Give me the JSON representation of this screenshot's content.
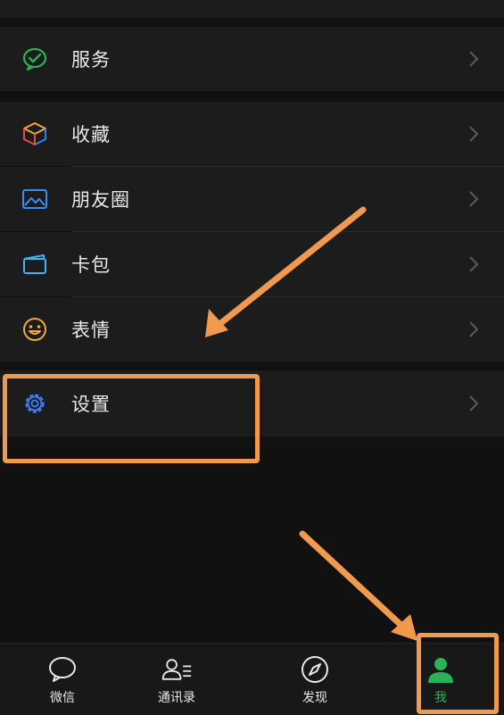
{
  "menu": {
    "services_label": "服务",
    "favorites_label": "收藏",
    "moments_label": "朋友圈",
    "cards_label": "卡包",
    "stickers_label": "表情",
    "settings_label": "设置"
  },
  "tabs": {
    "chats_label": "微信",
    "contacts_label": "通讯录",
    "discover_label": "发现",
    "me_label": "我"
  },
  "colors": {
    "accent_green": "#2bb256",
    "highlight_orange": "#f19a4e",
    "settings_blue": "#3b7cf5"
  },
  "icons": [
    "wechat-pay-icon",
    "box-icon",
    "image-icon",
    "card-icon",
    "smile-icon",
    "gear-icon",
    "chat-bubble-icon",
    "contacts-icon",
    "compass-icon",
    "person-icon"
  ]
}
